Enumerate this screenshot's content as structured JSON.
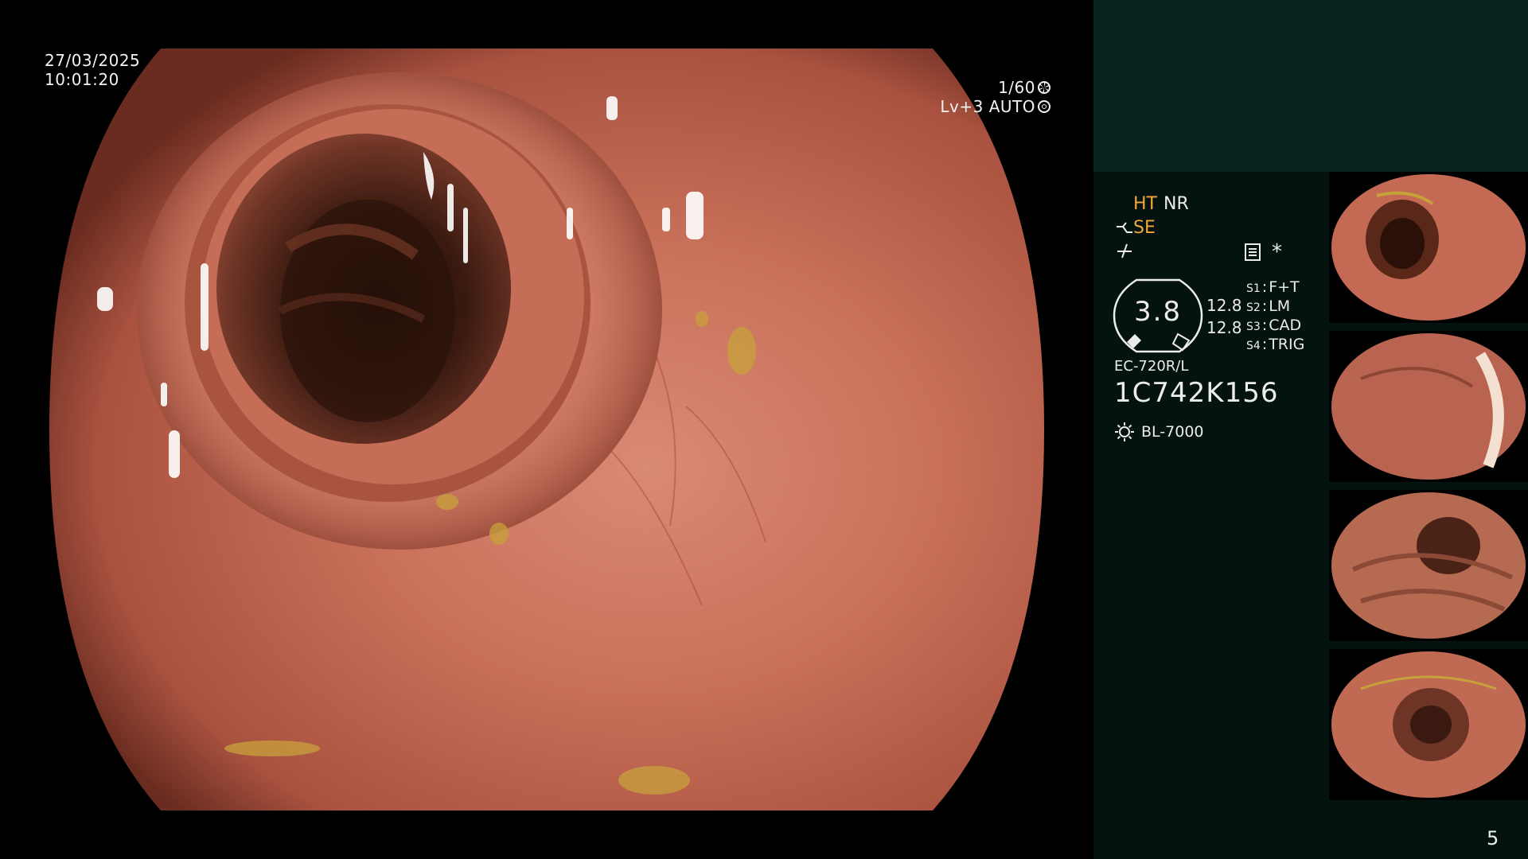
{
  "overlay": {
    "date": "27/03/2025",
    "time": "10:01:20",
    "shutter": "1/60",
    "level_mode": "Lv+3 AUTO"
  },
  "panel": {
    "mode_ht": "HT",
    "mode_nr": "NR",
    "mode_se": "SE",
    "asterisk": "*",
    "gauge_value": "3.8",
    "gauge_side_value_1": "12.8",
    "gauge_side_value_2": "12.8",
    "settings": [
      {
        "key": "S1",
        "value": "F+T"
      },
      {
        "key": "S2",
        "value": "LM"
      },
      {
        "key": "S3",
        "value": "CAD"
      },
      {
        "key": "S4",
        "value": "TRIG"
      }
    ],
    "scope_model": "EC-720R/L",
    "scope_serial": "1C742K156",
    "light_source": "BL-7000",
    "page_number": "5"
  },
  "thumbnails": [
    {
      "label": "thumbnail-1",
      "lumen": "left"
    },
    {
      "label": "thumbnail-2",
      "lumen": "right"
    },
    {
      "label": "thumbnail-3",
      "lumen": "center-right"
    },
    {
      "label": "thumbnail-4",
      "lumen": "center"
    }
  ],
  "colors": {
    "accent_orange": "#f0a83a",
    "panel_top": "#082420",
    "panel_bottom": "#041210",
    "mucosa": "#c86a55"
  },
  "icons": {
    "shutter": "shutter-icon",
    "auto": "iris-icon",
    "filter": "filter-menu-icon",
    "light": "sun-icon",
    "se": "structure-enhance-icon",
    "color": "color-mode-icon"
  }
}
